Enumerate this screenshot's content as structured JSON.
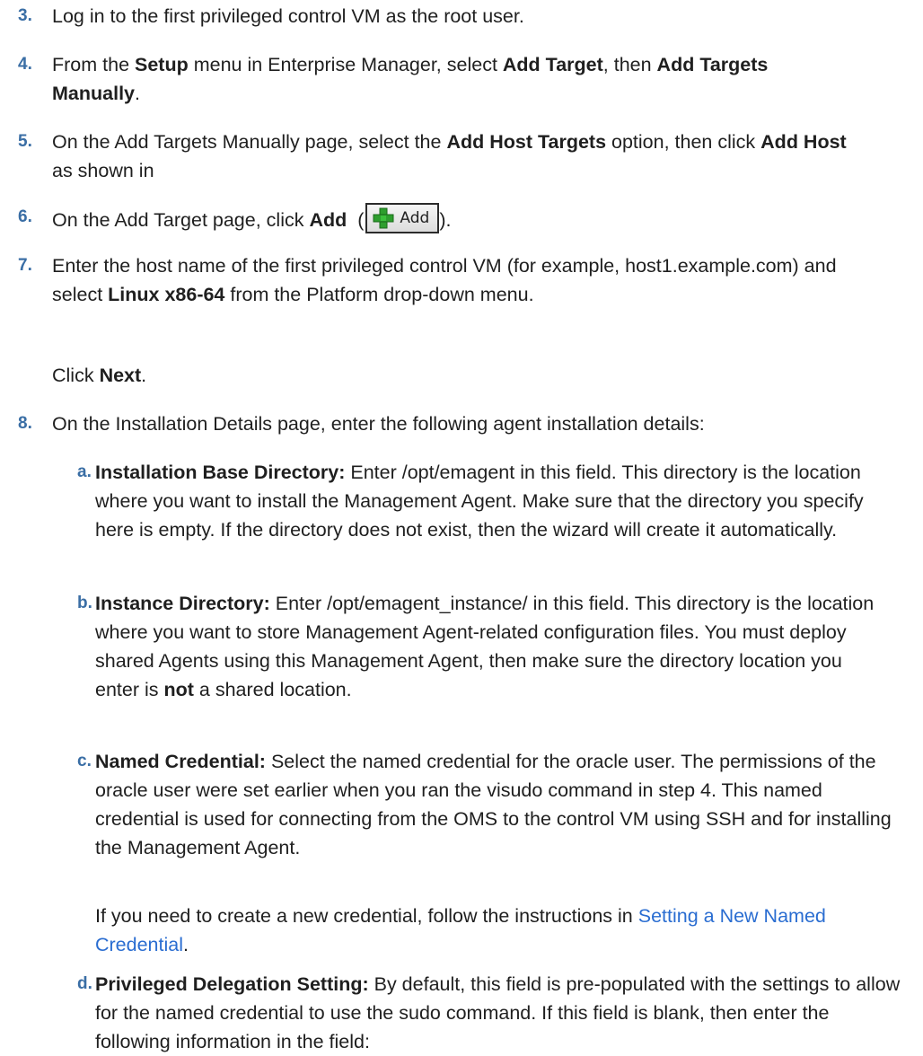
{
  "colors": {
    "accent": "#3a6ea5",
    "link": "#2a6dd1"
  },
  "steps": [
    {
      "num": "3.",
      "t0": "Log in to the first privileged control VM as the root user."
    },
    {
      "num": "4.",
      "t0": "From the ",
      "b0": "Setup",
      "t1": " menu in Enterprise Manager, select ",
      "b1": "Add Target",
      "t2": ", then ",
      "b2": "Add Targets Manually",
      "t3": "."
    },
    {
      "num": "5.",
      "t0": "On the Add Targets Manually page, select the ",
      "b0": "Add Host Targets",
      "t1": " option, then click ",
      "b1": "Add Host",
      "t2": " as shown in"
    },
    {
      "num": "6.",
      "t0": "On the Add Target page, click ",
      "b0": "Add",
      "t1": "  (",
      "icon_label": "Add",
      "icon": "green-plus-icon",
      "t2": ")."
    },
    {
      "num": "7.",
      "t0": "Enter the host name of the first privileged control VM (for example, host1.example.com) and select ",
      "b0": "Linux x86-64",
      "t1": " from the Platform drop-down menu.",
      "p0": "Click ",
      "pb0": "Next",
      "p1": "."
    },
    {
      "num": "8.",
      "t0": "On the Installation Details page, enter the following agent installation details:"
    }
  ],
  "substeps": [
    {
      "letter": "a.",
      "b0": "Installation Base Directory:",
      "t0": " Enter /opt/emagent in this field. This directory is the location where you want to install the Management Agent. Make sure that the directory you specify here is empty. If the directory does not exist, then the wizard will create it automatically."
    },
    {
      "letter": "b.",
      "b0": "Instance Directory:",
      "t0": " Enter /opt/emagent_instance/ in this field. This directory is the location where you want to store Management Agent-related configuration files. You must deploy shared Agents using this Management Agent, then make sure the directory location you enter is ",
      "b1": "not",
      "t1": " a shared location."
    },
    {
      "letter": "c.",
      "b0": "Named Credential:",
      "t0": " Select the named credential for the oracle user. The permissions of the oracle user were set earlier when you ran the visudo command in step 4. This named credential is used for connecting from the OMS to the control VM using SSH and for installing the Management Agent.",
      "p0": "If you need to create a new credential, follow the instructions in ",
      "link": "Setting a New Named Credential",
      "p1": "."
    },
    {
      "letter": "d.",
      "b0": "Privileged Delegation Setting:",
      "t0": " By default, this field is pre-populated with the settings to allow for the named credential to use the sudo command. If this field is blank, then enter the following information in the field:"
    }
  ]
}
